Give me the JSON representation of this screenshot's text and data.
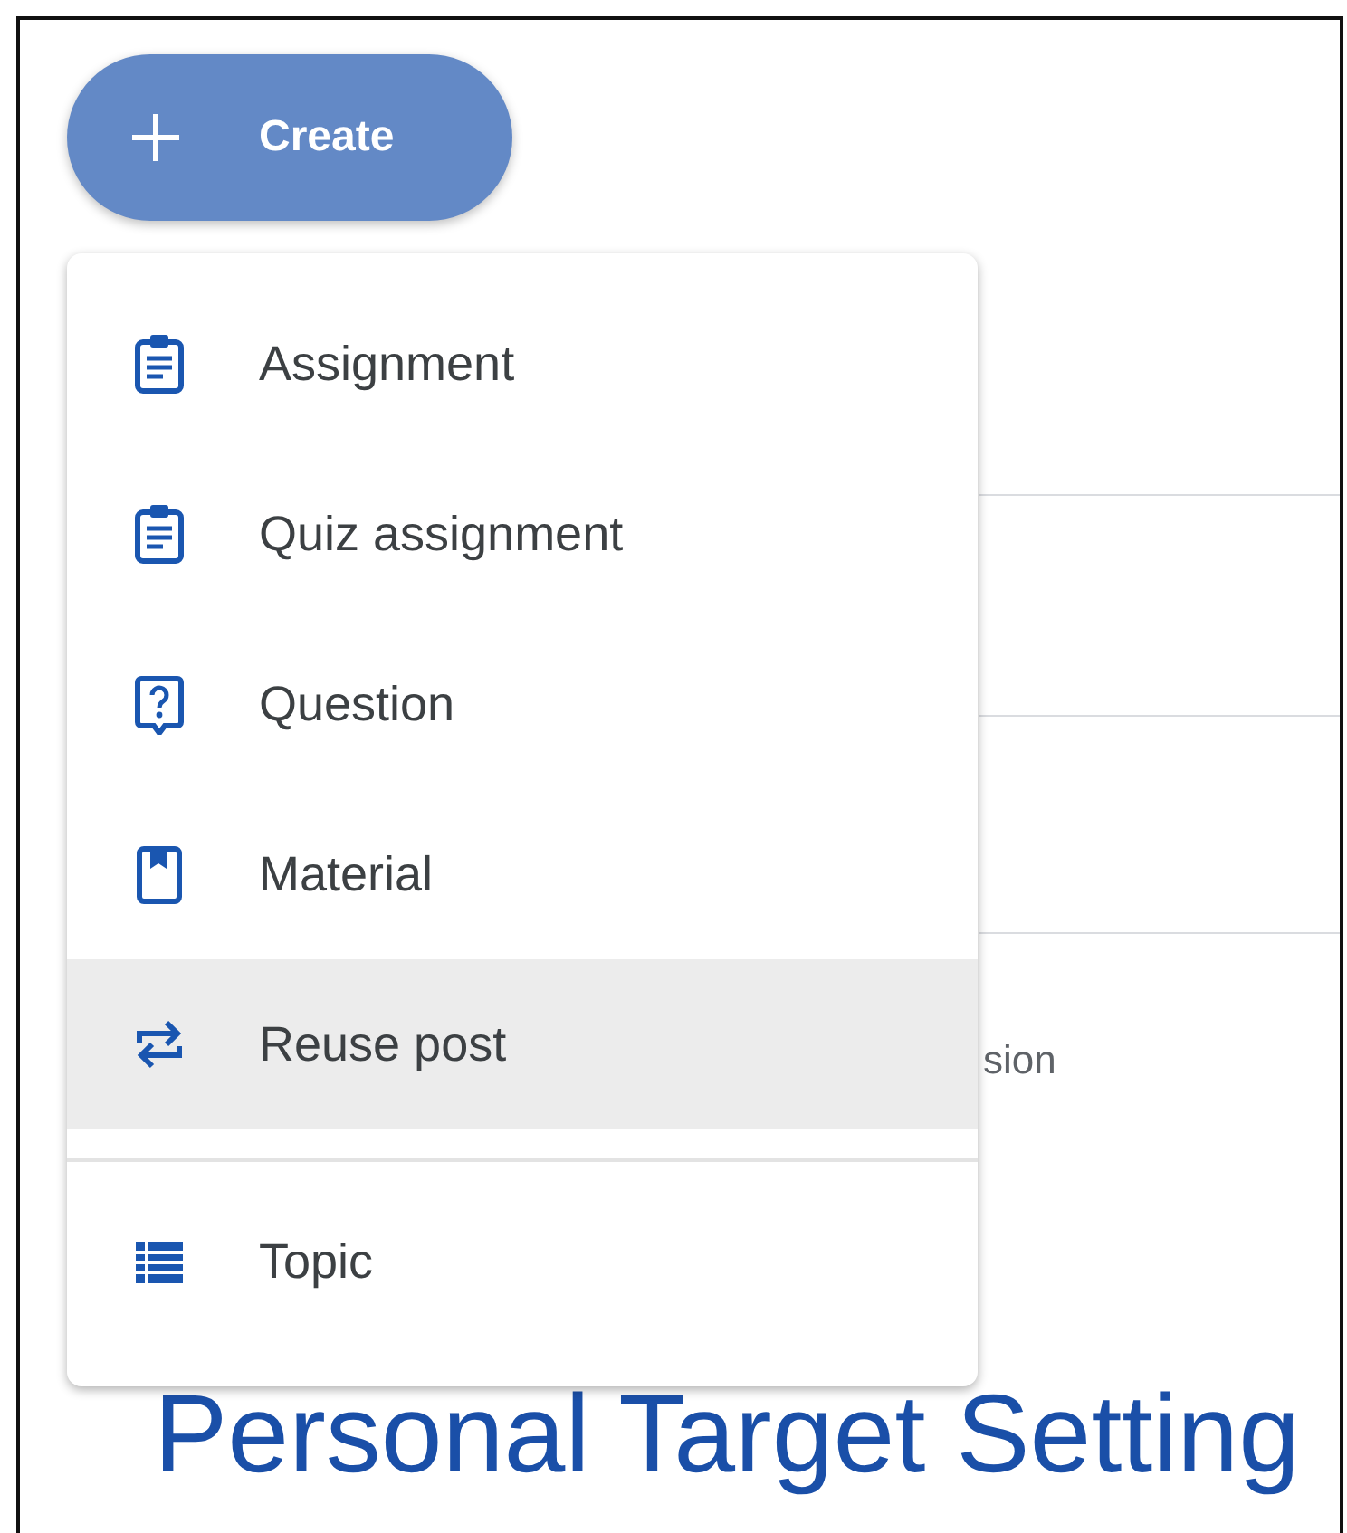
{
  "create_button": {
    "label": "Create"
  },
  "background": {
    "row_text": "sion",
    "title": "Personal Target Setting"
  },
  "menu": {
    "sections": [
      [
        {
          "label": "Assignment",
          "kind": "assignment",
          "selected": false
        },
        {
          "label": "Quiz assignment",
          "kind": "assignment",
          "selected": false
        },
        {
          "label": "Question",
          "kind": "question",
          "selected": false
        },
        {
          "label": "Material",
          "kind": "material",
          "selected": false
        },
        {
          "label": "Reuse post",
          "kind": "reuse",
          "selected": true
        }
      ],
      [
        {
          "label": "Topic",
          "kind": "topic",
          "selected": false
        }
      ]
    ]
  }
}
